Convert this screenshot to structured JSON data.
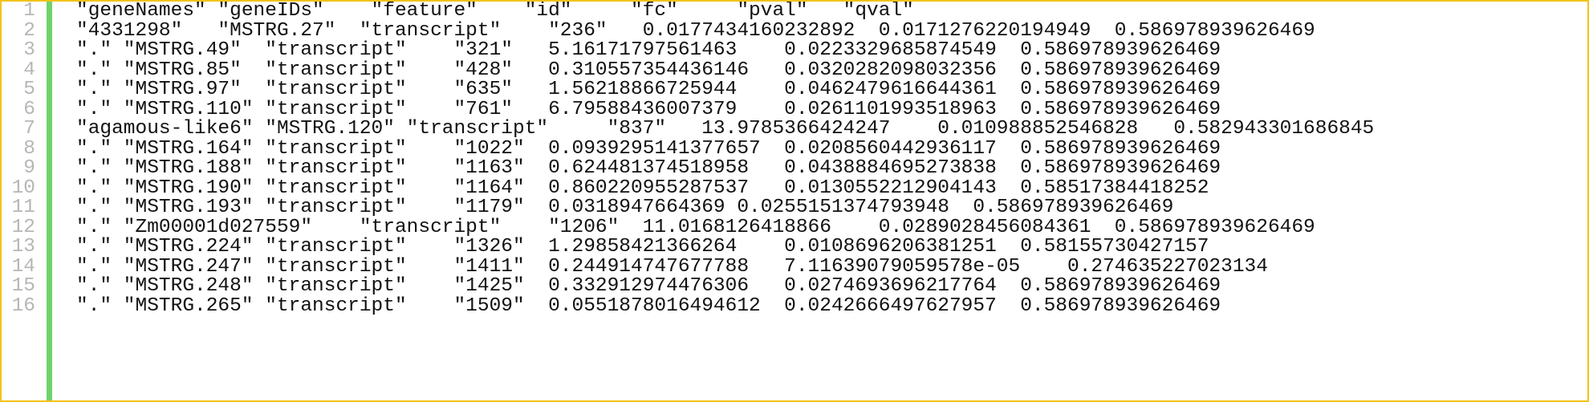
{
  "colors": {
    "frame_border": "#f3c21b",
    "gutter_bar": "#6fd36a",
    "line_number": "#b6b6b6",
    "text": "#111111",
    "background": "#ffffff"
  },
  "editor": {
    "lines": [
      {
        "number": "1",
        "text": "\"geneNames\" \"geneIDs\"    \"feature\"    \"id\"     \"fc\"     \"pval\"   \"qval\""
      },
      {
        "number": "2",
        "text": "\"4331298\"   \"MSTRG.27\"  \"transcript\"    \"236\"   0.0177434160232892  0.0171276220194949  0.586978939626469"
      },
      {
        "number": "3",
        "text": "\".\" \"MSTRG.49\"  \"transcript\"    \"321\"   5.16171797561463    0.0223329685874549  0.586978939626469"
      },
      {
        "number": "4",
        "text": "\".\" \"MSTRG.85\"  \"transcript\"    \"428\"   0.310557354436146   0.0320282098032356  0.586978939626469"
      },
      {
        "number": "5",
        "text": "\".\" \"MSTRG.97\"  \"transcript\"    \"635\"   1.56218866725944    0.0462479616644361  0.586978939626469"
      },
      {
        "number": "6",
        "text": "\".\" \"MSTRG.110\" \"transcript\"    \"761\"   6.79588436007379    0.0261101993518963  0.586978939626469"
      },
      {
        "number": "7",
        "text": "\"agamous-like6\" \"MSTRG.120\" \"transcript\"     \"837\"   13.9785366424247    0.010988852546828   0.582943301686845"
      },
      {
        "number": "8",
        "text": "\".\" \"MSTRG.164\" \"transcript\"    \"1022\"  0.0939295141377657  0.0208560442936117  0.586978939626469"
      },
      {
        "number": "9",
        "text": "\".\" \"MSTRG.188\" \"transcript\"    \"1163\"  0.624481374518958   0.0438884695273838  0.586978939626469"
      },
      {
        "number": "10",
        "text": "\".\" \"MSTRG.190\" \"transcript\"    \"1164\"  0.860220955287537   0.0130552212904143  0.58517384418252"
      },
      {
        "number": "11",
        "text": "\".\" \"MSTRG.193\" \"transcript\"    \"1179\"  0.0318947664369 0.0255151374793948  0.586978939626469"
      },
      {
        "number": "12",
        "text": "\".\" \"Zm00001d027559\"    \"transcript\"    \"1206\"  11.0168126418866    0.0289028456084361  0.586978939626469"
      },
      {
        "number": "13",
        "text": "\".\" \"MSTRG.224\" \"transcript\"    \"1326\"  1.29858421366264    0.0108696206381251  0.58155730427157"
      },
      {
        "number": "14",
        "text": "\".\" \"MSTRG.247\" \"transcript\"    \"1411\"  0.244914747677788   7.11639079059578e-05    0.274635227023134"
      },
      {
        "number": "15",
        "text": "\".\" \"MSTRG.248\" \"transcript\"    \"1425\"  0.332912974476306   0.0274693696217764  0.586978939626469"
      },
      {
        "number": "16",
        "text": "\".\" \"MSTRG.265\" \"transcript\"    \"1509\"  0.0551878016494612  0.0242666497627957  0.586978939626469"
      }
    ]
  }
}
